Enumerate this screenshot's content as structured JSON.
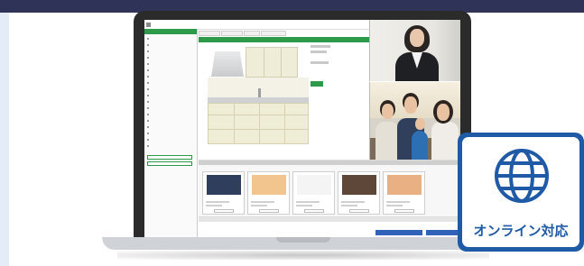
{
  "colors": {
    "top_band": "#2f3357",
    "app_accent": "#2d9a4a",
    "badge_blue": "#1f5aa6",
    "action_blue": "#2f62b8"
  },
  "app": {
    "logo_text": "",
    "sidebar": {
      "title": "",
      "items": [
        "",
        "",
        "",
        "",
        "",
        "",
        "",
        "",
        "",
        "",
        "",
        "",
        "",
        "",
        "",
        "",
        "",
        ""
      ],
      "actions": [
        "",
        ""
      ]
    },
    "tabs": [
      "",
      "",
      "",
      ""
    ],
    "section_title": "",
    "spec": {
      "lines": [
        "",
        "",
        ""
      ],
      "button": ""
    },
    "swatches": {
      "title": "",
      "subtitle": "",
      "items": [
        {
          "color": "#2e3e5c",
          "label": "",
          "button": ""
        },
        {
          "color": "#f2c58f",
          "label": "",
          "button": ""
        },
        {
          "color": "#f4f4f4",
          "label": "",
          "button": ""
        },
        {
          "color": "#5e4638",
          "label": "",
          "button": ""
        },
        {
          "color": "#e8b083",
          "label": "",
          "button": ""
        }
      ]
    },
    "footer": {
      "bar": "",
      "left_text": "",
      "right_text": "",
      "buttons": [
        "",
        ""
      ]
    }
  },
  "badge": {
    "icon": "globe-icon",
    "label": "オンライン対応"
  }
}
